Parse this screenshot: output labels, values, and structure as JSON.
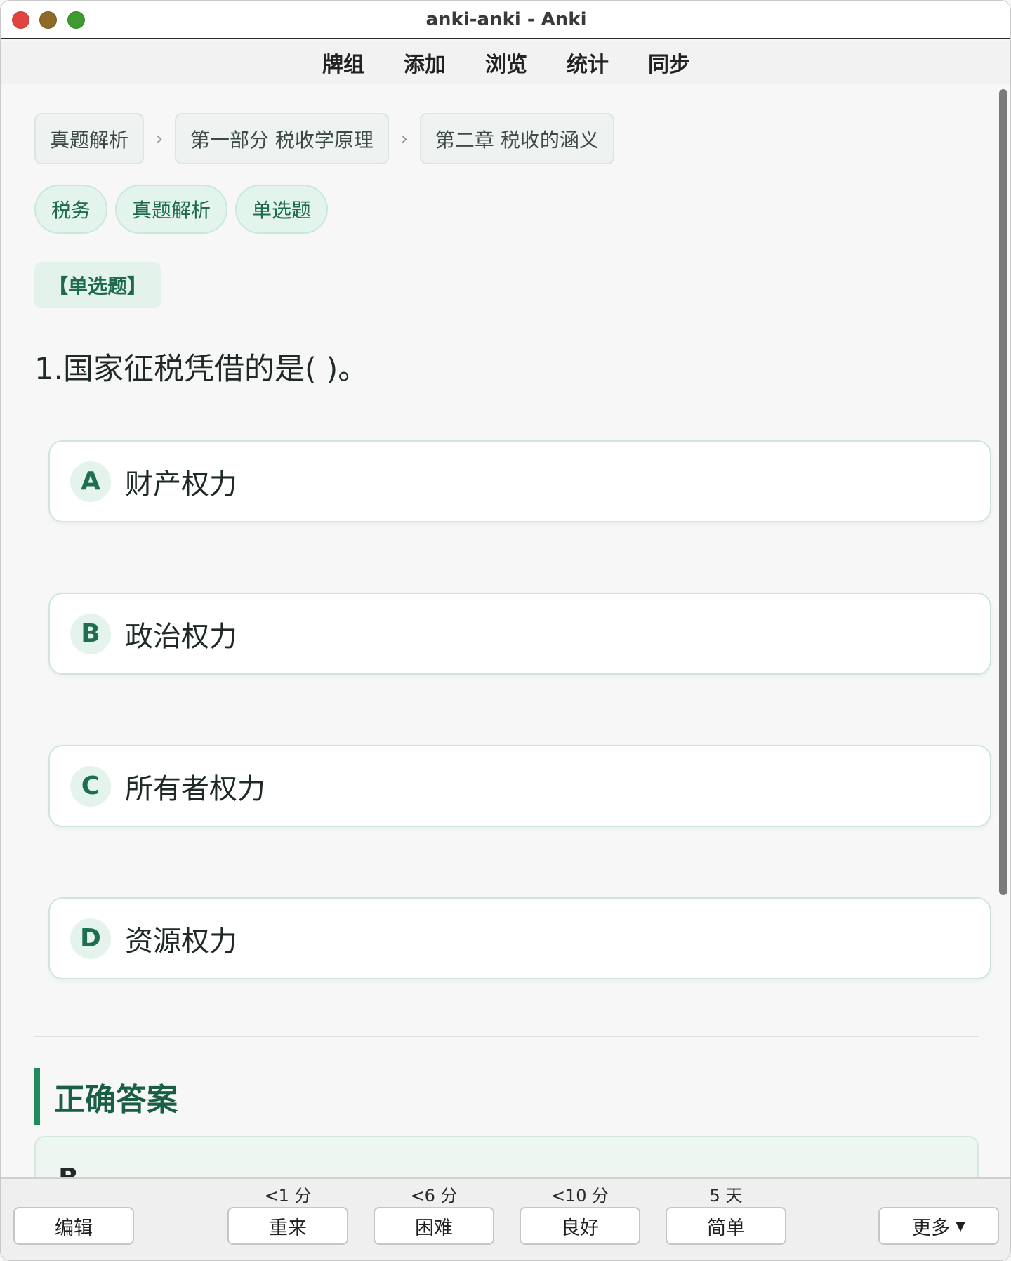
{
  "window": {
    "title": "anki-anki - Anki"
  },
  "topmenu": {
    "items": [
      "牌组",
      "添加",
      "浏览",
      "统计",
      "同步"
    ]
  },
  "breadcrumbs": [
    "真题解析",
    "第一部分 税收学原理",
    "第二章 税收的涵义"
  ],
  "tags": [
    "税务",
    "真题解析",
    "单选题"
  ],
  "question": {
    "type_label": "【单选题】",
    "text": "1.国家征税凭借的是( )。",
    "options": [
      {
        "letter": "A",
        "text": "财产权力"
      },
      {
        "letter": "B",
        "text": "政治权力"
      },
      {
        "letter": "C",
        "text": "所有者权力"
      },
      {
        "letter": "D",
        "text": "资源权力"
      }
    ]
  },
  "answer": {
    "heading": "正确答案",
    "value": "B"
  },
  "bottombar": {
    "edit_label": "编辑",
    "more_label": "更多",
    "ease_buttons": [
      {
        "label": "重来",
        "time": "<1 分"
      },
      {
        "label": "困难",
        "time": "<6 分"
      },
      {
        "label": "良好",
        "time": "<10 分"
      },
      {
        "label": "简单",
        "time": "5 天"
      }
    ]
  },
  "colors": {
    "accent": "#1f8a5c",
    "tag_bg": "#e2f4ec",
    "option_border": "#cfe5dc"
  }
}
